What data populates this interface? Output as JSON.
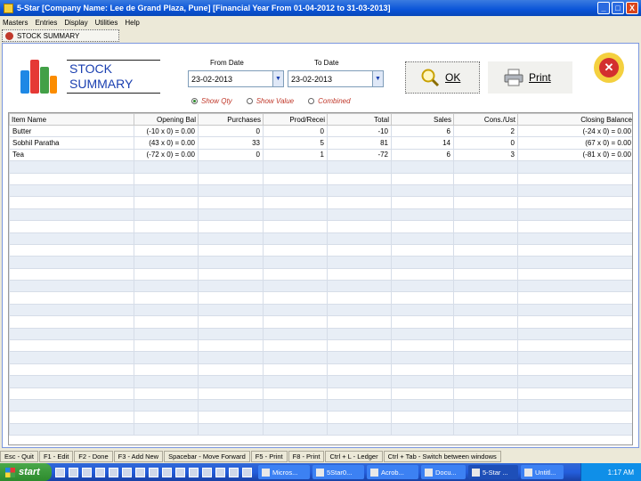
{
  "window": {
    "title": "5-Star [Company Name: Lee de Grand Plaza, Pune] [Financial Year From 01-04-2012 to 31-03-2013]",
    "btn_min": "_",
    "btn_max": "□",
    "btn_close": "X"
  },
  "menu": [
    "Masters",
    "Entries",
    "Display",
    "Utilities",
    "Help"
  ],
  "doc_tab": "STOCK SUMMARY",
  "form": {
    "title_line1": "STOCK",
    "title_line2": "SUMMARY",
    "from_label": "From Date",
    "to_label": "To Date",
    "from_value": "23-02-2013",
    "to_value": "23-02-2013",
    "dropdown_glyph": "▼",
    "radios": [
      {
        "label": "Show Qty",
        "selected": true
      },
      {
        "label": "Show Value",
        "selected": false
      },
      {
        "label": "Combined",
        "selected": false
      }
    ],
    "ok_label": "OK",
    "print_label": "Print",
    "close_glyph": "✕"
  },
  "table": {
    "columns": [
      "Item Name",
      "Opening Bal",
      "Purchases",
      "Prod/Recei",
      "Total",
      "Sales",
      "Cons./Ust",
      "Closing Balance"
    ],
    "rows": [
      [
        "Butter",
        "(-10 x 0) = 0.00",
        "0",
        "0",
        "-10",
        "6",
        "2",
        "(-24 x 0) = 0.00"
      ],
      [
        "Sobhil Paratha",
        "(43 x 0) = 0.00",
        "33",
        "5",
        "81",
        "14",
        "0",
        "(67 x 0) = 0.00"
      ],
      [
        "Tea",
        "(-72 x 0) = 0.00",
        "0",
        "1",
        "-72",
        "6",
        "3",
        "(-81 x 0) = 0.00"
      ]
    ]
  },
  "status": [
    "Esc - Quit",
    "F1 - Edit",
    "F2 - Done",
    "F3 - Add New",
    "Spacebar - Move Forward",
    "F5 - Print",
    "F8 - Print",
    "Ctrl + L - Ledger",
    "Ctrl + Tab - Switch between windows"
  ],
  "taskbar": {
    "start": "start",
    "tasks": [
      "Micros...",
      "5Star0...",
      "Acrob...",
      "Docu...",
      "5-Star ...",
      "Untitl..."
    ],
    "clock": "1:17 AM"
  },
  "colors": {
    "accent": "#1a3fb0",
    "radio_text": "#c0392b",
    "alt_row": "#e8eef6"
  }
}
